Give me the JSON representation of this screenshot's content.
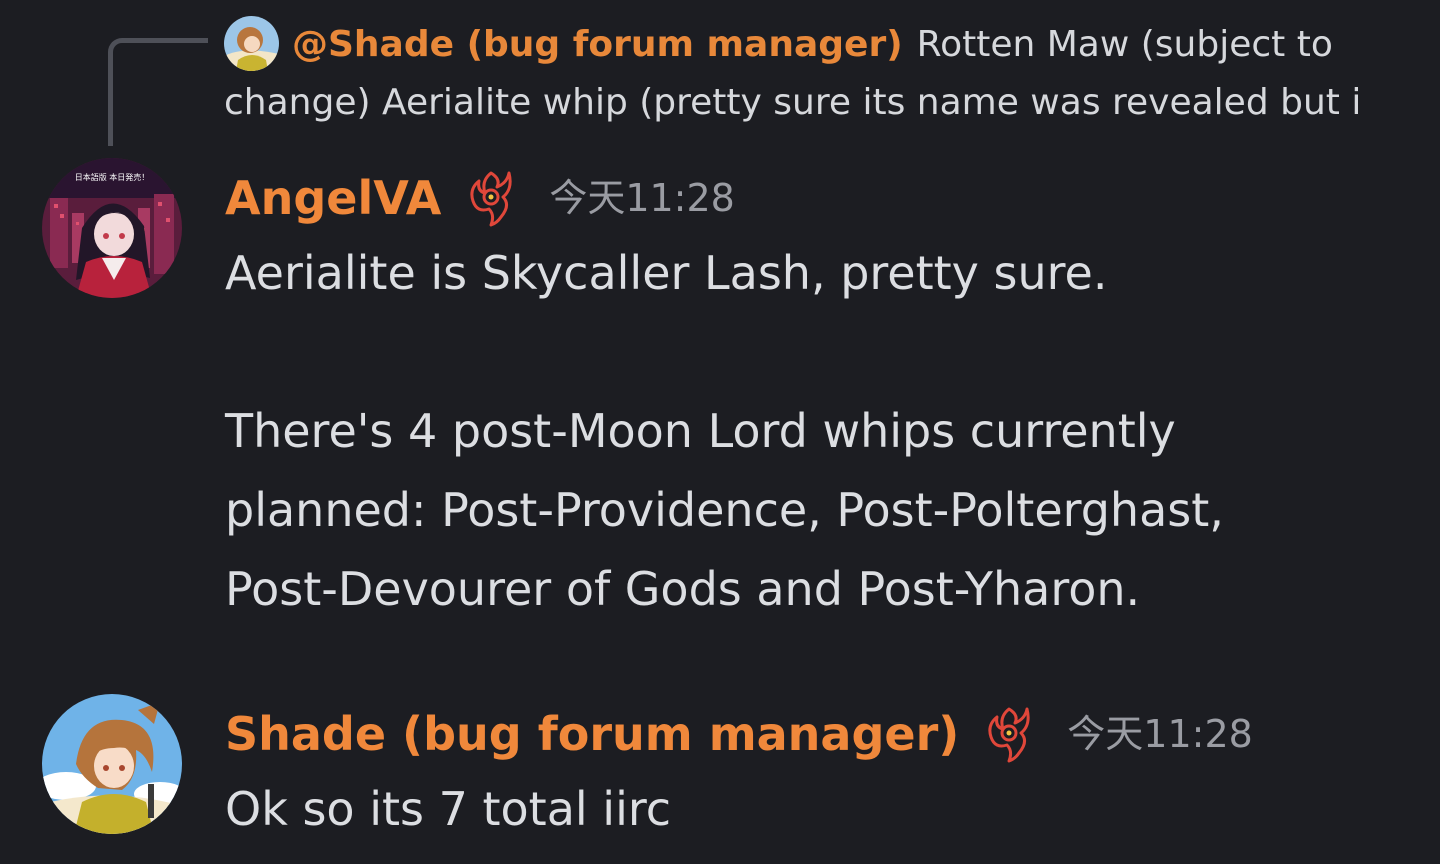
{
  "reply": {
    "mention": "@Shade (bug forum manager)",
    "preview": "Rotten Maw (subject to change) Aerialite whip (pretty sure its name was revealed but i"
  },
  "messages": [
    {
      "author": "AngelVA",
      "role_icon": "flame-sword-icon",
      "timestamp": "今天11:28",
      "avatar_caption": "日本語版 本日発売！",
      "paragraphs": [
        "Aerialite is Skycaller Lash, pretty sure.",
        "There's 4 post-Moon Lord whips currently",
        "planned: Post-Providence, Post-Polterghast,",
        "Post-Devourer of Gods and Post-Yharon."
      ]
    },
    {
      "author": "Shade (bug forum manager)",
      "role_icon": "flame-sword-icon",
      "timestamp": "今天11:28",
      "paragraphs": [
        "Ok so its 7 total iirc"
      ]
    }
  ],
  "colors": {
    "background": "#1c1d22",
    "username": "#f0883b",
    "text": "#dcdee2",
    "timestamp": "#9a9ca3",
    "role_icon": "#e0473a"
  }
}
